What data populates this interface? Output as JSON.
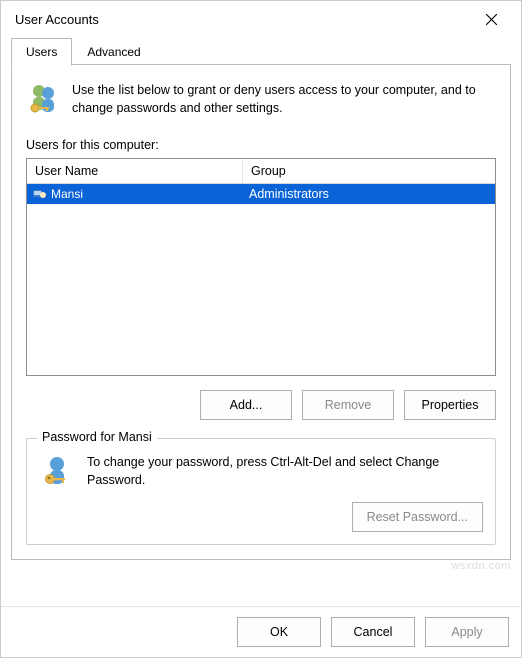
{
  "title": "User Accounts",
  "tabs": {
    "users": "Users",
    "advanced": "Advanced"
  },
  "intro": "Use the list below to grant or deny users access to your computer, and to change passwords and other settings.",
  "list_label": "Users for this computer:",
  "columns": {
    "name": "User Name",
    "group": "Group"
  },
  "rows": [
    {
      "name": "Mansi",
      "group": "Administrators",
      "selected": true
    }
  ],
  "buttons": {
    "add": "Add...",
    "remove": "Remove",
    "properties": "Properties",
    "reset_password": "Reset Password...",
    "ok": "OK",
    "cancel": "Cancel",
    "apply": "Apply"
  },
  "password_section": {
    "legend": "Password for Mansi",
    "text": "To change your password, press Ctrl-Alt-Del and select Change Password."
  },
  "watermark": "wsxdn.com"
}
